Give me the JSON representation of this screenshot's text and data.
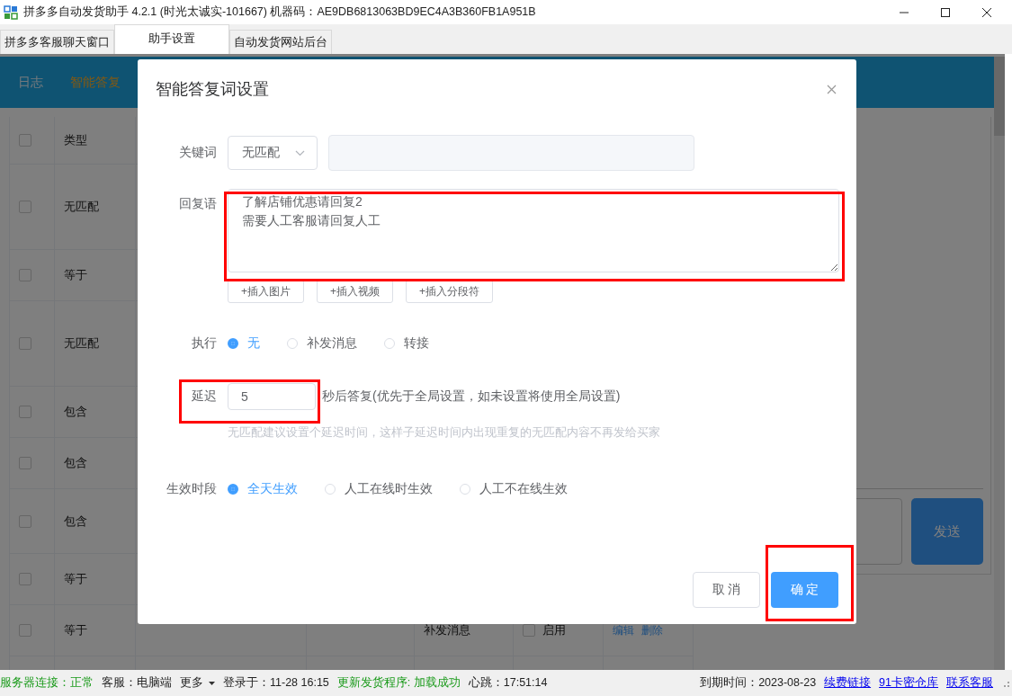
{
  "window": {
    "title": "拼多多自动发货助手 4.2.1 (时光太诚实-101667) 机器码：AE9DB6813063BD9EC4A3B360FB1A951B"
  },
  "tabs": [
    {
      "label": "拼多多客服聊天窗口",
      "selected": false
    },
    {
      "label": "助手设置",
      "selected": true
    },
    {
      "label": "自动发货网站后台",
      "selected": false
    }
  ],
  "nav": [
    {
      "label": "日志",
      "selected": false
    },
    {
      "label": "智能答复",
      "selected": true
    }
  ],
  "table": {
    "columns": [
      "类型"
    ],
    "all_checked": false,
    "rows": [
      {
        "type": "无匹配",
        "checked": false
      },
      {
        "type": "等于",
        "checked": false
      },
      {
        "type": "无匹配",
        "checked": false
      },
      {
        "type": "包含",
        "checked": false
      },
      {
        "type": "包含",
        "checked": false
      },
      {
        "type": "包含",
        "checked": false
      },
      {
        "type": "等于",
        "checked": false
      },
      {
        "type": "等于",
        "checked": false,
        "action": "补发消息",
        "enable": {
          "label": "启用",
          "checked": false
        },
        "links": [
          "编辑",
          "删除"
        ]
      }
    ]
  },
  "chat": {
    "send_button": "发送"
  },
  "modal": {
    "title": "智能答复词设置",
    "keyword": {
      "label": "关键词",
      "match": "无匹配"
    },
    "reply": {
      "label": "回复语",
      "value": "了解店铺优惠请回复2\n需要人工客服请回复人工"
    },
    "insert_buttons": [
      "+插入图片",
      "+插入视频",
      "+插入分段符"
    ],
    "execute": {
      "label": "执行",
      "options": [
        {
          "label": "无",
          "selected": true
        },
        {
          "label": "补发消息",
          "selected": false
        },
        {
          "label": "转接",
          "selected": false
        }
      ]
    },
    "delay": {
      "label": "延迟",
      "value": "5",
      "suffix": "秒后答复(优先于全局设置，如未设置将使用全局设置)",
      "hint": "无匹配建议设置个延迟时间，这样子延迟时间内出现重复的无匹配内容不再发给买家"
    },
    "active_period": {
      "label": "生效时段",
      "options": [
        {
          "label": "全天生效",
          "selected": true
        },
        {
          "label": "人工在线时生效",
          "selected": false
        },
        {
          "label": "人工不在线生效",
          "selected": false
        }
      ]
    },
    "cancel_button": "取 消",
    "confirm_button": "确 定"
  },
  "status_bar": {
    "left": [
      {
        "kind": "ok",
        "text": "服务器连接：正常"
      },
      {
        "kind": "text",
        "text": "客服：电脑端"
      },
      {
        "kind": "menu",
        "text": "更多"
      },
      {
        "kind": "text",
        "text": "登录于：11-28 16:15"
      },
      {
        "kind": "ok",
        "text": "更新发货程序: 加载成功"
      },
      {
        "kind": "text",
        "text": "心跳：17:51:14"
      }
    ],
    "right": [
      {
        "kind": "text",
        "text": "到期时间：2023-08-23"
      },
      {
        "kind": "link",
        "text": "续费链接"
      },
      {
        "kind": "link",
        "text": "91卡密仓库"
      },
      {
        "kind": "link",
        "text": "联系客服"
      }
    ]
  }
}
